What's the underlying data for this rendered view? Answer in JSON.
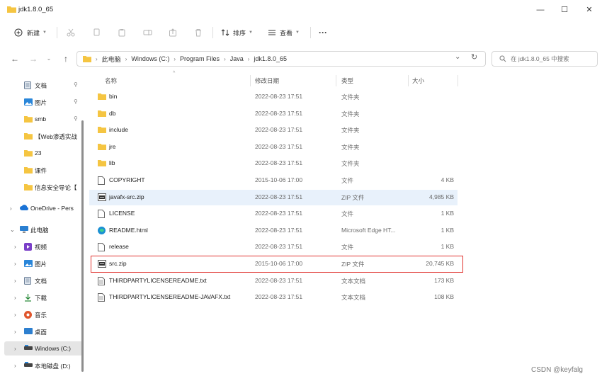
{
  "window": {
    "title": "jdk1.8.0_65",
    "controls": {
      "minimize": "—",
      "maximize": "☐",
      "close": "✕"
    }
  },
  "toolbar": {
    "new_label": "新建",
    "sort_label": "排序",
    "view_label": "查看",
    "more_label": "···"
  },
  "address": {
    "crumbs": [
      "此电脑",
      "Windows (C:)",
      "Program Files",
      "Java",
      "jdk1.8.0_65"
    ]
  },
  "search": {
    "placeholder": "在 jdk1.8.0_65 中搜索"
  },
  "sidebar": {
    "items": [
      {
        "label": "文档",
        "icon": "document-icon",
        "pinned": true
      },
      {
        "label": "图片",
        "icon": "pictures-icon",
        "pinned": true
      },
      {
        "label": "smb",
        "icon": "folder-icon",
        "pinned": true
      },
      {
        "label": "【Web渗透实战",
        "icon": "folder-icon",
        "pinned": false
      },
      {
        "label": "23",
        "icon": "folder-icon",
        "pinned": false
      },
      {
        "label": "课件",
        "icon": "folder-icon",
        "pinned": false
      },
      {
        "label": "信息安全导论【",
        "icon": "folder-icon",
        "pinned": false
      },
      {
        "label": "OneDrive - Pers",
        "icon": "cloud-icon",
        "pinned": false
      },
      {
        "label": "此电脑",
        "icon": "computer-icon",
        "pinned": false
      },
      {
        "label": "视频",
        "icon": "video-icon",
        "pinned": false
      },
      {
        "label": "图片",
        "icon": "pictures-icon",
        "pinned": false
      },
      {
        "label": "文档",
        "icon": "document-icon",
        "pinned": false
      },
      {
        "label": "下载",
        "icon": "download-icon",
        "pinned": false
      },
      {
        "label": "音乐",
        "icon": "music-icon",
        "pinned": false
      },
      {
        "label": "桌面",
        "icon": "desktop-icon",
        "pinned": false
      },
      {
        "label": "Windows (C:)",
        "icon": "drive-icon",
        "pinned": false
      },
      {
        "label": "本地磁盘 (D:)",
        "icon": "drive-icon",
        "pinned": false
      }
    ]
  },
  "columns": {
    "name": "名称",
    "date": "修改日期",
    "type": "类型",
    "size": "大小"
  },
  "files": [
    {
      "name": "bin",
      "date": "2022-08-23 17:51",
      "type": "文件夹",
      "size": "",
      "icon": "folder-icon"
    },
    {
      "name": "db",
      "date": "2022-08-23 17:51",
      "type": "文件夹",
      "size": "",
      "icon": "folder-icon"
    },
    {
      "name": "include",
      "date": "2022-08-23 17:51",
      "type": "文件夹",
      "size": "",
      "icon": "folder-icon"
    },
    {
      "name": "jre",
      "date": "2022-08-23 17:51",
      "type": "文件夹",
      "size": "",
      "icon": "folder-icon"
    },
    {
      "name": "lib",
      "date": "2022-08-23 17:51",
      "type": "文件夹",
      "size": "",
      "icon": "folder-icon"
    },
    {
      "name": "COPYRIGHT",
      "date": "2015-10-06 17:00",
      "type": "文件",
      "size": "4 KB",
      "icon": "file-icon"
    },
    {
      "name": "javafx-src.zip",
      "date": "2022-08-23 17:51",
      "type": "ZIP 文件",
      "size": "4,985 KB",
      "icon": "zip-icon"
    },
    {
      "name": "LICENSE",
      "date": "2022-08-23 17:51",
      "type": "文件",
      "size": "1 KB",
      "icon": "file-icon"
    },
    {
      "name": "README.html",
      "date": "2022-08-23 17:51",
      "type": "Microsoft Edge HT...",
      "size": "1 KB",
      "icon": "edge-icon"
    },
    {
      "name": "release",
      "date": "2022-08-23 17:51",
      "type": "文件",
      "size": "1 KB",
      "icon": "file-icon"
    },
    {
      "name": "src.zip",
      "date": "2015-10-06 17:00",
      "type": "ZIP 文件",
      "size": "20,745 KB",
      "icon": "zip-icon"
    },
    {
      "name": "THIRDPARTYLICENSEREADME.txt",
      "date": "2022-08-23 17:51",
      "type": "文本文档",
      "size": "173 KB",
      "icon": "text-icon"
    },
    {
      "name": "THIRDPARTYLICENSEREADME-JAVAFX.txt",
      "date": "2022-08-23 17:51",
      "type": "文本文档",
      "size": "108 KB",
      "icon": "text-icon"
    }
  ],
  "watermark": "CSDN @keyfalg",
  "colors": {
    "highlight_border": "#e0332f",
    "folder": "#f5c542",
    "selected_row": "#e8f1fb"
  }
}
